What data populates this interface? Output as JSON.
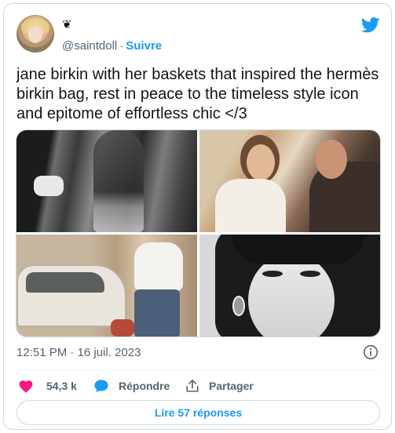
{
  "user": {
    "display_name": "❦",
    "handle": "@saintdoll",
    "separator": "·",
    "follow_label": "Suivre"
  },
  "tweet": {
    "text": "jane birkin with her baskets that inspired the hermès birkin bag, rest in peace to the timeless style icon and epitome of effortless chic </3",
    "timestamp": "12:51 PM · 16 juil. 2023"
  },
  "actions": {
    "like_count": "54,3 k",
    "reply_label": "Répondre",
    "share_label": "Partager"
  },
  "replies_button_label": "Lire 57 réponses",
  "colors": {
    "brand_blue": "#1d9bf0",
    "like_pink": "#f91880",
    "muted_text": "#536471"
  },
  "icons": [
    "twitter-bird-icon",
    "heart-icon",
    "reply-bubble-icon",
    "share-icon",
    "info-icon"
  ]
}
